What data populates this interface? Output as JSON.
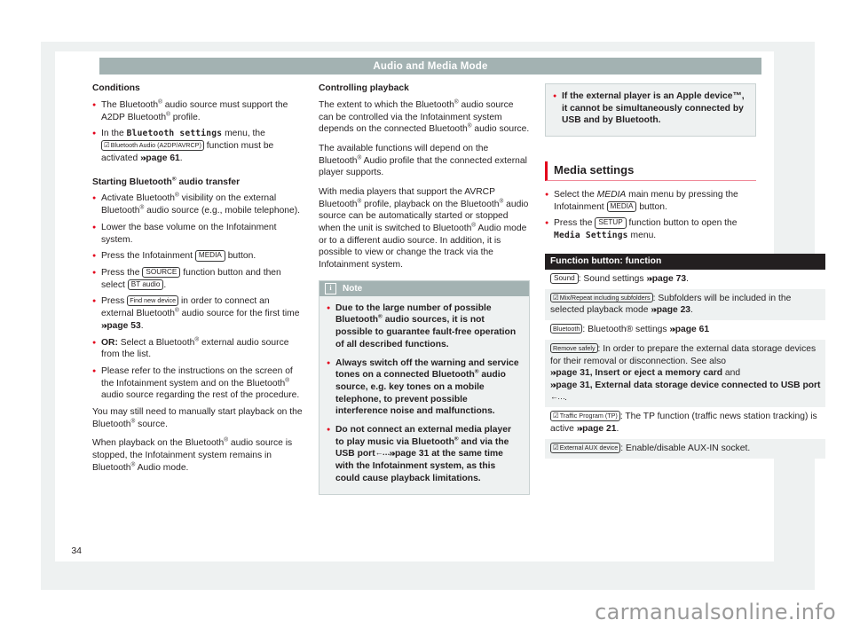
{
  "document": {
    "running_header": "Audio and Media Mode",
    "page_number": "34",
    "watermark": "carmanualsonline.info"
  },
  "left_column": {
    "heading_conditions": "Conditions",
    "bullet1_a": "The Bluetooth",
    "bullet1_b": " audio source must support the A2DP Bluetooth",
    "bullet1_c": " profile.",
    "bullet2_a": "In the ",
    "bullet2_menu": "Bluetooth settings",
    "bullet2_b": " menu, the ",
    "bullet2_chip": "Bluetooth Audio (A2DP/AVRCP)",
    "bullet2_c": " function must be activated ",
    "bullet2_ref": "page 61",
    "bullet2_d": ".",
    "heading_starting_a": "Starting Bluetooth",
    "heading_starting_b": " audio transfer",
    "bullet3_a": "Activate Bluetooth",
    "bullet3_b": " visibility on the external Bluetooth",
    "bullet3_c": " audio source (e.g., mobile telephone).",
    "bullet4": "Lower the base volume on the Infotainment system.",
    "bullet5_a": "Press the Infotainment ",
    "bullet5_chip": "MEDIA",
    "bullet5_b": " button.",
    "bullet6_a": "Press the ",
    "bullet6_chip1": "SOURCE",
    "bullet6_b": " function button and then select ",
    "bullet6_chip2": "BT audio",
    "bullet6_c": ".",
    "bullet7_a": "Press ",
    "bullet7_chip": "Find new device",
    "bullet7_b": " in order to connect an external Bluetooth",
    "bullet7_c": " audio source for the first time ",
    "bullet7_ref": "page 53",
    "bullet7_d": ".",
    "bullet8_or": "OR:",
    "bullet8_a": " Select a Bluetooth",
    "bullet8_b": " external audio source from the list.",
    "bullet9_a": "Please refer to the instructions on the screen of the Infotainment system and on the Bluetooth",
    "bullet9_b": " audio source regarding the rest of the procedure.",
    "para1_a": "You may still need to manually start playback on the Bluetooth",
    "para1_b": " source.",
    "para2_a": "When playback on the Bluetooth",
    "para2_b": " audio source is stopped, the Infotainment system remains in Bluetooth",
    "para2_c": " Audio mode."
  },
  "middle_column": {
    "heading_controlling": "Controlling playback",
    "para1_a": "The extent to which the Bluetooth",
    "para1_b": " audio source can be controlled via the Infotainment system depends on the connected Bluetooth",
    "para1_c": " audio source.",
    "para2_a": "The available functions will depend on the Bluetooth",
    "para2_b": " Audio profile that the connected external player supports.",
    "para3_a": "With media players that support the AVRCP Bluetooth",
    "para3_b": " profile, playback on the Bluetooth",
    "para3_c": " audio source can be automatically started or stopped when the unit is switched to Bluetooth",
    "para3_d": " Audio mode or to a different audio source. In addition, it is possible to view or change the track via the Infotainment system.",
    "note": {
      "title": "Note",
      "icon": "info-icon",
      "bullet1_a": "Due to the large number of possible Bluetooth",
      "bullet1_b": " audio sources, it is not possible to guarantee fault-free operation of all described functions.",
      "bullet2_a": "Always switch off the warning and service tones on a connected Bluetooth",
      "bullet2_b": " audio source, e.g. key tones on a mobile telephone, to prevent possible interference noise and malfunctions.",
      "bullet3_a": "Do not connect an external media player to play music via Bluetooth",
      "bullet3_b": " and via the USB port",
      "bullet3_ref": "page 31",
      "bullet3_c": " at the same time with the Infotainment system, as this could cause playback limitations."
    }
  },
  "right_column": {
    "apple_note": {
      "bullet_a": "If the external player is an Apple device™, it cannot be simultaneously connected by USB and by Bluetooth."
    },
    "section_heading": "Media settings",
    "bullet1_a": "Select the ",
    "bullet1_menu": "MEDIA",
    "bullet1_b": " main menu by pressing the Infotainment ",
    "bullet1_chip": "MEDIA",
    "bullet1_c": " button.",
    "bullet2_a": "Press the ",
    "bullet2_chip": "SETUP",
    "bullet2_b": " function button to open the ",
    "bullet2_menu": "Media Settings",
    "bullet2_c": " menu.",
    "table": {
      "header": "Function button: function",
      "rows": [
        {
          "chip": "Sound",
          "checkbox": false,
          "text_a": ": Sound settings ",
          "ref1": "page 73",
          "text_b": "."
        },
        {
          "chip": "Mix/Repeat including subfolders",
          "checkbox": true,
          "text_a": ": Subfolders will be included in the selected playback mode ",
          "ref1": "page 23",
          "text_b": "."
        },
        {
          "chip": "Bluetooth",
          "checkbox": false,
          "text_a": ": Bluetooth® settings ",
          "ref1": "page 61",
          "text_b": ""
        },
        {
          "chip": "Remove safely",
          "checkbox": false,
          "text_a": ": In order to prepare the external data storage devices for their removal or disconnection. See also ",
          "ref1": "page 31, Insert or eject a memory card",
          "text_b": " and ",
          "ref2": "page 31, External data storage device connected to USB port",
          "text_c": "."
        },
        {
          "chip": "Traffic Program (TP)",
          "checkbox": true,
          "text_a": ": The TP function (traffic news station tracking) is active ",
          "ref1": "page 21",
          "text_b": "."
        },
        {
          "chip": "External AUX device",
          "checkbox": true,
          "text_a": ": Enable/disable AUX-IN socket.",
          "ref1": "",
          "text_b": ""
        }
      ]
    }
  },
  "colors": {
    "accent_red": "#e3001b",
    "header_bar": "#a3b2b2",
    "box_bg": "#eef1f1",
    "table_header": "#231f20",
    "text": "#231f20"
  }
}
